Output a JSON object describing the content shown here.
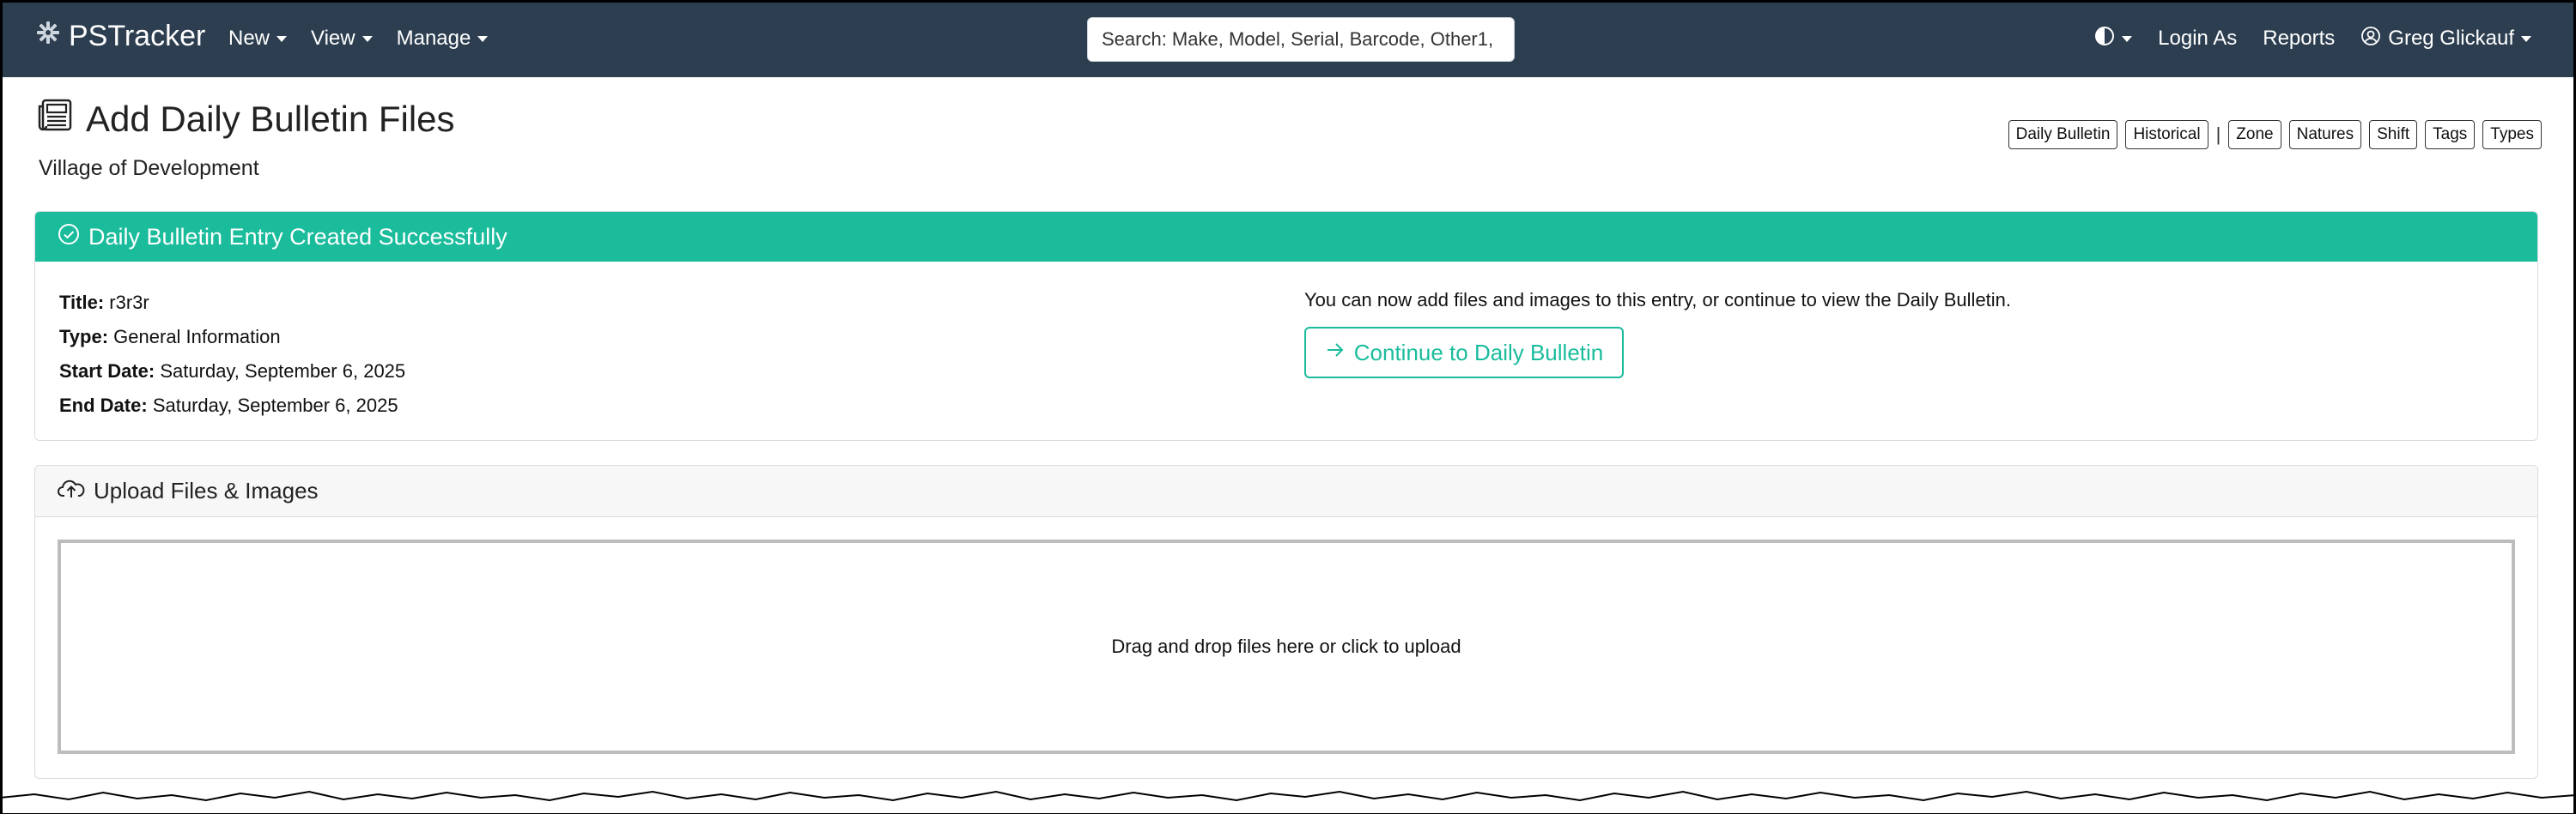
{
  "navbar": {
    "brand": "PSTracker",
    "menu": [
      {
        "label": "New"
      },
      {
        "label": "View"
      },
      {
        "label": "Manage"
      }
    ],
    "search_placeholder": "Search: Make, Model, Serial, Barcode, Other1,",
    "right": {
      "theme_icon": "half-circle-theme-icon",
      "login_as": "Login As",
      "reports": "Reports",
      "user_name": "Greg Glickauf"
    },
    "bg_color": "#2c3e50"
  },
  "page": {
    "title": "Add Daily Bulletin Files",
    "subtitle": "Village of Development",
    "quick_links": [
      "Daily Bulletin",
      "Historical",
      "Zone",
      "Natures",
      "Shift",
      "Tags",
      "Types"
    ],
    "quick_links_separator": "|"
  },
  "success_card": {
    "header": "Daily Bulletin Entry Created Successfully",
    "accent_color": "#1abc9c",
    "details": [
      {
        "label": "Title:",
        "value": "r3r3r"
      },
      {
        "label": "Type:",
        "value": "General Information"
      },
      {
        "label": "Start Date:",
        "value": "Saturday, September 6, 2025"
      },
      {
        "label": "End Date:",
        "value": "Saturday, September 6, 2025"
      }
    ],
    "message": "You can now add files and images to this entry, or continue to view the Daily Bulletin.",
    "continue_button": "Continue to Daily Bulletin"
  },
  "upload_card": {
    "header": "Upload Files & Images",
    "dropzone_text": "Drag and drop files here or click to upload"
  }
}
